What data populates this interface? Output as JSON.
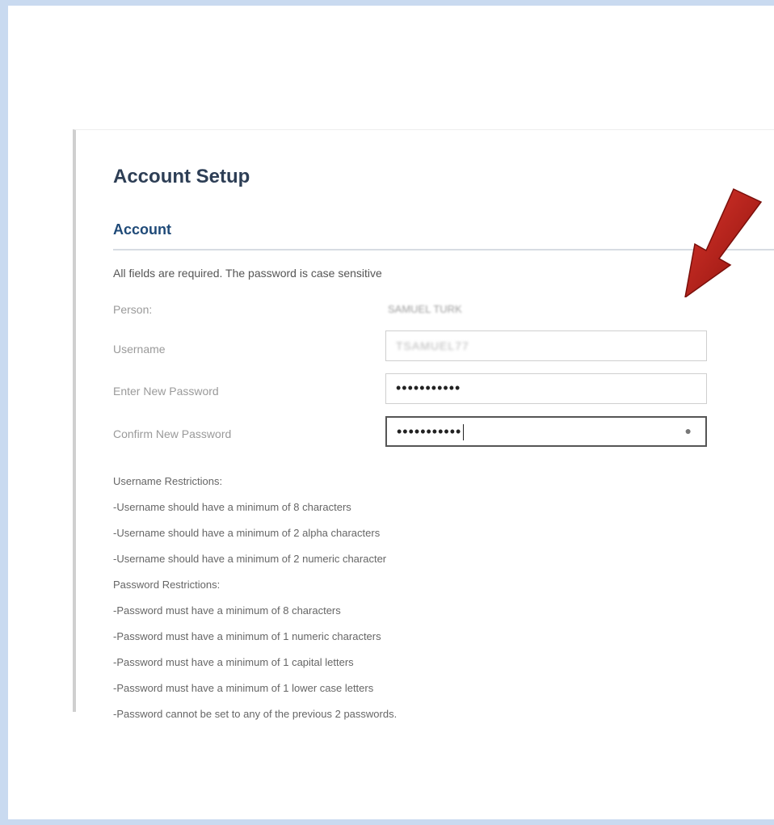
{
  "page": {
    "title": "Account Setup",
    "section": "Account",
    "note": "All fields are required. The password is case sensitive"
  },
  "form": {
    "person_label": "Person:",
    "person_value": "SAMUEL TURK",
    "username_label": "Username",
    "username_value": "TSAMUEL77",
    "password_label": "Enter New Password",
    "password_value": "•••••••••••",
    "confirm_label": "Confirm New Password",
    "confirm_value": "•••••••••••",
    "confirm_icon": "clear-icon"
  },
  "username_rules": {
    "heading": "Username Restrictions:",
    "items": [
      "-Username should have a minimum of 8 characters",
      "-Username should have a minimum of 2 alpha characters",
      "-Username should have a minimum of 2 numeric character"
    ]
  },
  "password_rules": {
    "heading": "Password Restrictions:",
    "items": [
      "-Password must have a minimum of 8 characters",
      "-Password must have a minimum of 1 numeric characters",
      "-Password must have a minimum of 1 capital letters",
      "-Password must have a minimum of 1 lower case letters",
      "-Password cannot be set to any of the previous 2 passwords."
    ]
  },
  "colors": {
    "frame": "#c9daf0",
    "title": "#2d3e55",
    "section": "#1f4a78",
    "arrow": "#b51a14"
  },
  "icons": {
    "annotation": "red-arrow-icon"
  }
}
